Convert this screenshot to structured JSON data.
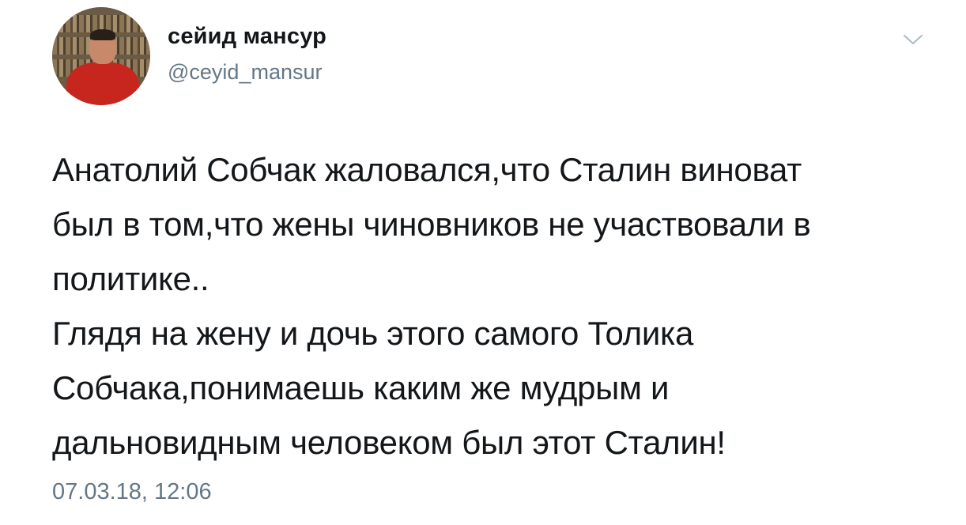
{
  "tweet": {
    "author": {
      "display_name": "сейид мансур",
      "handle": "@ceyid_mansur"
    },
    "text_lines": [
      "Анатолий Собчак жаловался,что Сталин виноват",
      "был в том,что жены чиновников не участвовали в",
      "политике..",
      "Глядя на жену и дочь этого самого Толика",
      "Собчака,понимаешь каким же мудрым и",
      "дальновидным человеком был этот Сталин!"
    ],
    "timestamp": "07.03.18, 12:06"
  },
  "icons": {
    "menu": "chevron-down-icon",
    "avatar": "profile-photo"
  },
  "colors": {
    "text": "#14171a",
    "secondary": "#657786",
    "chevron": "#aab8c2",
    "background": "#ffffff"
  }
}
